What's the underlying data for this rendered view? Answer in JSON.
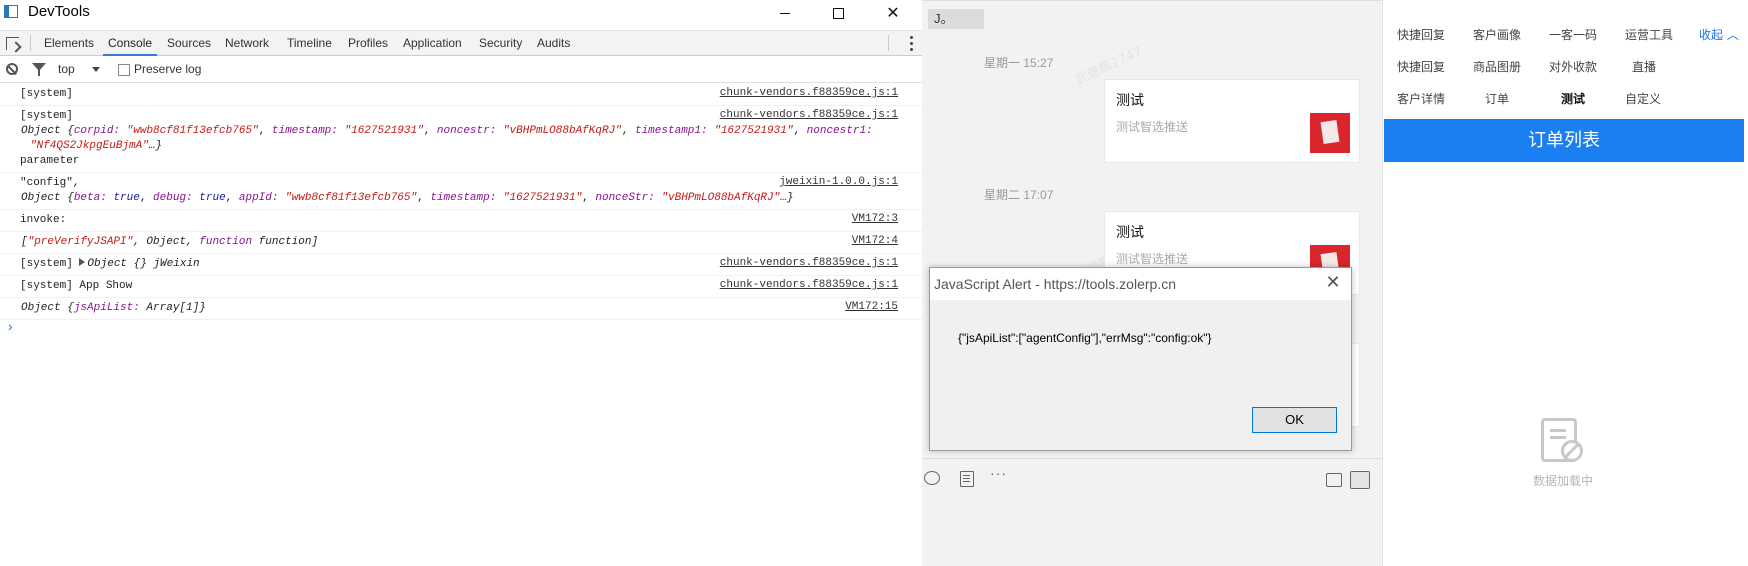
{
  "devtools": {
    "window_title": "DevTools",
    "window_controls": {
      "minimize": "—",
      "maximize": "☐",
      "close": "✕"
    },
    "tabs": [
      "Elements",
      "Console",
      "Sources",
      "Network",
      "Timeline",
      "Profiles",
      "Application",
      "Security",
      "Audits"
    ],
    "active_tab": "Console",
    "filter": {
      "context": "top",
      "preserve_log_label": "Preserve log",
      "preserve_log_checked": false
    },
    "console": {
      "src_vendors": "chunk-vendors.f88359ce.js:1",
      "src_jweixin": "jweixin-1.0.0.js:1",
      "src_vm3": "VM172:3",
      "src_vm4": "VM172:4",
      "src_vm15": "VM172:15",
      "l1": "[system]",
      "l2": "[system]",
      "obj1_prefix": "Object {",
      "corpid_key": "corpid:",
      "corpid_val": "\"wwb8cf81f13efcb765\"",
      "timestamp_key": "timestamp:",
      "timestamp_val": "\"1627521931\"",
      "noncestr_key": "noncestr:",
      "noncestr_val": "\"vBHPmLO88bAfKqRJ\"",
      "timestamp1_key": "timestamp1:",
      "timestamp1_val": "\"1627521931\"",
      "noncestr1_key": "noncestr1:",
      "noncestr1_val": "\"Nf4QS2JkpgEuBjmA\"",
      "obj1_suffix": "…}",
      "l3": "parameter",
      "l4": "\"config\",",
      "obj2_prefix": "Object {",
      "beta_key": "beta:",
      "beta_val": "true",
      "debug_key": "debug:",
      "debug_val": "true",
      "appid_key": "appId:",
      "appid_val": "\"wwb8cf81f13efcb765\"",
      "ts2_key": "timestamp:",
      "ts2_val": "\"1627521931\"",
      "nonce2_key": "nonceStr:",
      "nonce2_val": "\"vBHPmLO88bAfKqRJ\"",
      "obj2_suffix": "…}",
      "l5": "invoke:",
      "arr_open": "[",
      "arr_str": "\"preVerifyJSAPI\"",
      "arr_mid": ", Object, ",
      "arr_fn_kw": "function",
      "arr_fn": " function]",
      "l6_a": "[system]",
      "l6_b": "Object {} jWeixin",
      "l7": "[system] App Show",
      "obj3_prefix": "Object {",
      "jsapi_key": "jsApiList:",
      "jsapi_val": " Array[1]}",
      "prompt": "›"
    }
  },
  "chat": {
    "top_snippet": "J。",
    "ts1": "星期一 15:27",
    "ts2": "星期二 17:07",
    "card_title": "测试",
    "card_desc": "测试智选推送",
    "watermark": "武建鹏2747",
    "watermark2": "14",
    "tool_more": "···"
  },
  "side": {
    "row1": [
      "快捷回复",
      "客户画像",
      "一客一码",
      "运营工具"
    ],
    "collapse": "收起 ︿",
    "row2": [
      "快捷回复",
      "商品图册",
      "对外收款",
      "直播"
    ],
    "row3": [
      "客户详情",
      "订单",
      "测试",
      "自定义"
    ],
    "orders_title": "订单列表",
    "empty_text": "数据加载中"
  },
  "alert": {
    "title": "JavaScript Alert - https://tools.zolerp.cn",
    "message": "{\"jsApiList\":[\"agentConfig\"],\"errMsg\":\"config:ok\"}",
    "ok_label": "OK",
    "close": "✕"
  }
}
